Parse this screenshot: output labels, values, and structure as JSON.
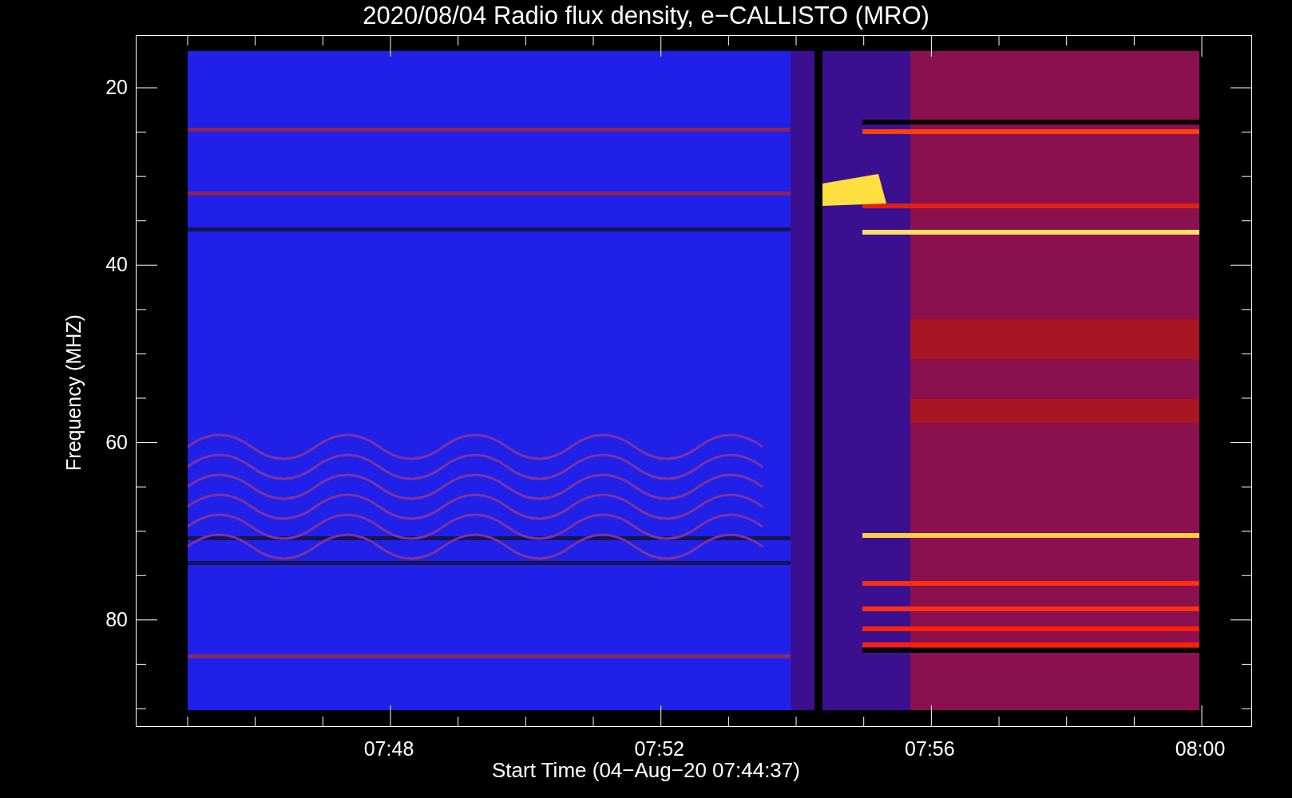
{
  "title": "2020/08/04  Radio flux density, e−CALLISTO (MRO)",
  "y_axis": {
    "label": "Frequency (MHZ)",
    "ticks": [
      "20",
      "40",
      "60",
      "80"
    ]
  },
  "x_axis": {
    "label": "Start Time (04−Aug−20 07:44:37)",
    "ticks": [
      "07:48",
      "07:52",
      "07:56",
      "08:00"
    ]
  }
}
